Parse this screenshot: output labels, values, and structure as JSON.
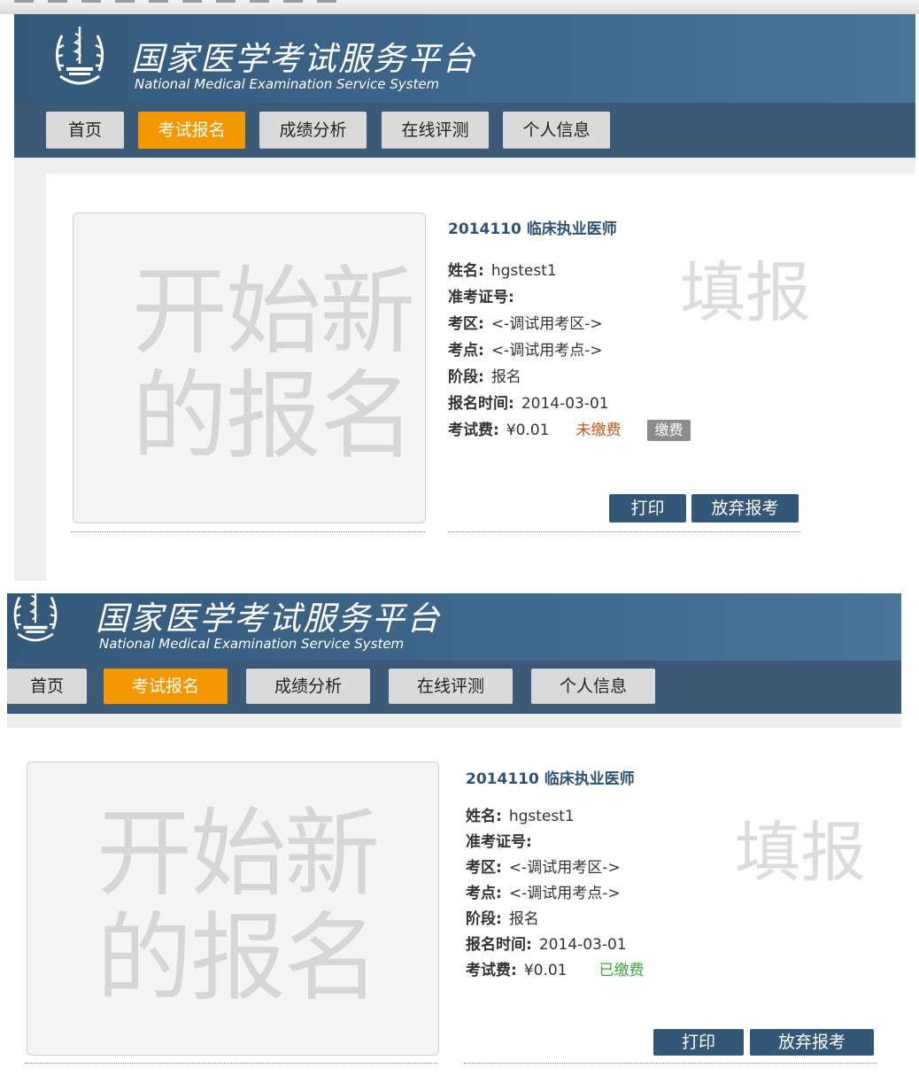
{
  "platform": {
    "title_cn": "国家医学考试服务平台",
    "title_en": "National Medical Examination Service System"
  },
  "nav": [
    "首页",
    "考试报名",
    "成绩分析",
    "在线评测",
    "个人信息"
  ],
  "active_nav": "考试报名",
  "new_signup": {
    "line1": "开始新",
    "line2": "的报名"
  },
  "labels": {
    "name": "姓名:",
    "ticket": "准考证号:",
    "region": "考区:",
    "site": "考点:",
    "stage": "阶段:",
    "signup_time": "报名时间:",
    "fee": "考试费:"
  },
  "stamp": "填报",
  "buttons": {
    "print": "打印",
    "abandon": "放弃报考",
    "pay": "缴费"
  },
  "screens": [
    {
      "exam_title": "2014110 临床执业医师",
      "name": "hgstest1",
      "ticket": "",
      "region": "<-调试用考区->",
      "site": "<-调试用考点->",
      "stage": "报名",
      "signup_time": "2014-03-01",
      "fee": "¥0.01",
      "pay_status": "未缴费"
    },
    {
      "exam_title": "2014110 临床执业医师",
      "name": "hgstest1",
      "ticket": "",
      "region": "<-调试用考区->",
      "site": "<-调试用考点->",
      "stage": "报名",
      "signup_time": "2014-03-01",
      "fee": "¥0.01",
      "pay_status": "已缴费"
    }
  ],
  "colors": {
    "header_blue": "#3f6a8e",
    "nav_bar": "#3a5a77",
    "active_orange": "#f39800",
    "unpaid": "#c2571a",
    "paid": "#3aa33a",
    "button_blue": "#335776"
  }
}
